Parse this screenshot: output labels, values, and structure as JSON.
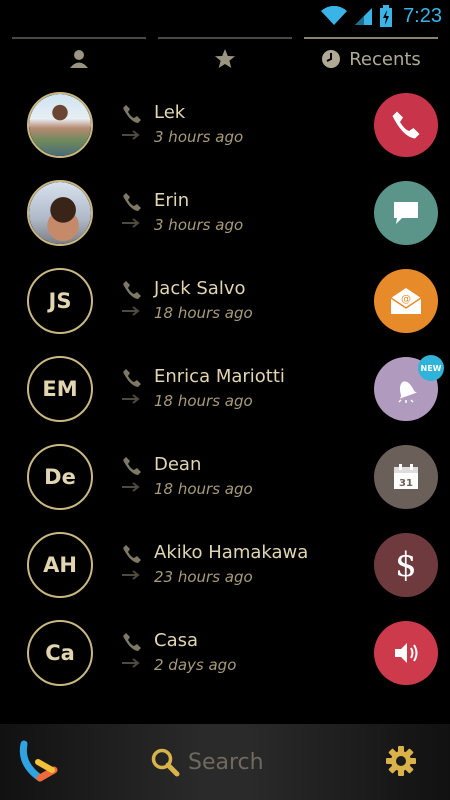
{
  "status_bar": {
    "time": "7:23"
  },
  "tabs": [
    {
      "icon": "person-icon",
      "label": ""
    },
    {
      "icon": "star-icon",
      "label": ""
    },
    {
      "icon": "clock-icon",
      "label": "Recents",
      "active": true
    }
  ],
  "recents": [
    {
      "name": "Lek",
      "time": "3 hours ago",
      "avatar": "photo",
      "action": "call",
      "action_color": "#c8344a"
    },
    {
      "name": "Erin",
      "time": "3 hours ago",
      "avatar": "photo",
      "action": "message",
      "action_color": "#5b9488"
    },
    {
      "name": "Jack Salvo",
      "initials": "JS",
      "time": "18 hours ago",
      "action": "email",
      "action_color": "#e78a2a"
    },
    {
      "name": "Enrica Mariotti",
      "initials": "EM",
      "time": "18 hours ago",
      "action": "alarm",
      "action_color": "#b09abd",
      "badge": "NEW"
    },
    {
      "name": "Dean",
      "initials": "De",
      "time": "18 hours ago",
      "action": "calendar",
      "action_color": "#6b5f59"
    },
    {
      "name": "Akiko Hamakawa",
      "initials": "AH",
      "time": "23 hours ago",
      "action": "money",
      "action_color": "#6e3a3e",
      "action_glyph": "$"
    },
    {
      "name": "Casa",
      "initials": "Ca",
      "time": "2 days ago",
      "action": "sound",
      "action_color": "#cc3a4c"
    }
  ],
  "calendar_day": "31",
  "bottom_bar": {
    "search_label": "Search"
  }
}
